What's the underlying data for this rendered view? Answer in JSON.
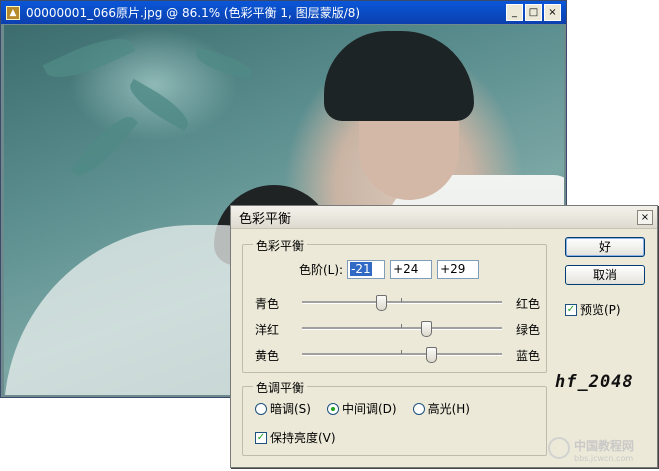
{
  "document_window": {
    "title": "00000001_066原片.jpg @ 86.1% (色彩平衡 1, 图层蒙版/8)",
    "minimize": "_",
    "maximize": "□",
    "close": "×"
  },
  "dialog": {
    "title": "色彩平衡",
    "close": "×",
    "color_balance_group": {
      "legend": "色彩平衡",
      "levels_label": "色阶(L):",
      "levels": [
        "-21",
        "+24",
        "+29"
      ],
      "sliders": [
        {
          "left": "青色",
          "right": "红色",
          "value": -21
        },
        {
          "left": "洋红",
          "right": "绿色",
          "value": 24
        },
        {
          "left": "黄色",
          "right": "蓝色",
          "value": 29
        }
      ]
    },
    "tone_balance_group": {
      "legend": "色调平衡",
      "shadows": "暗调(S)",
      "midtones": "中间调(D)",
      "highlights": "高光(H)",
      "selected": "midtones",
      "preserve_luminosity": "保持亮度(V)",
      "preserve_luminosity_checked": true
    },
    "ok_button": "好",
    "cancel_button": "取消",
    "preview_label": "预览(P)",
    "preview_checked": true
  },
  "signature": "hf_2048",
  "watermark": {
    "title": "中国教程网",
    "url": "bbs.jcwcn.com"
  }
}
